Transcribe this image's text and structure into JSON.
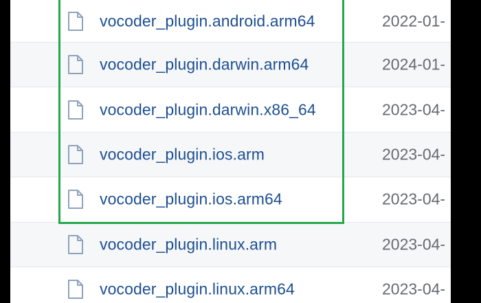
{
  "files": [
    {
      "name": "vocoder_plugin.android.arm64",
      "date": "2022-01-"
    },
    {
      "name": "vocoder_plugin.darwin.arm64",
      "date": "2024-01-"
    },
    {
      "name": "vocoder_plugin.darwin.x86_64",
      "date": "2023-04-"
    },
    {
      "name": "vocoder_plugin.ios.arm",
      "date": "2023-04-"
    },
    {
      "name": "vocoder_plugin.ios.arm64",
      "date": "2023-04-"
    },
    {
      "name": "vocoder_plugin.linux.arm",
      "date": "2023-04-"
    },
    {
      "name": "vocoder_plugin.linux.arm64",
      "date": "2023-04-"
    }
  ],
  "icons": {
    "file": "file-icon"
  },
  "colors": {
    "link": "#1d4f91",
    "highlight": "#22a84a",
    "date": "#666a70"
  }
}
